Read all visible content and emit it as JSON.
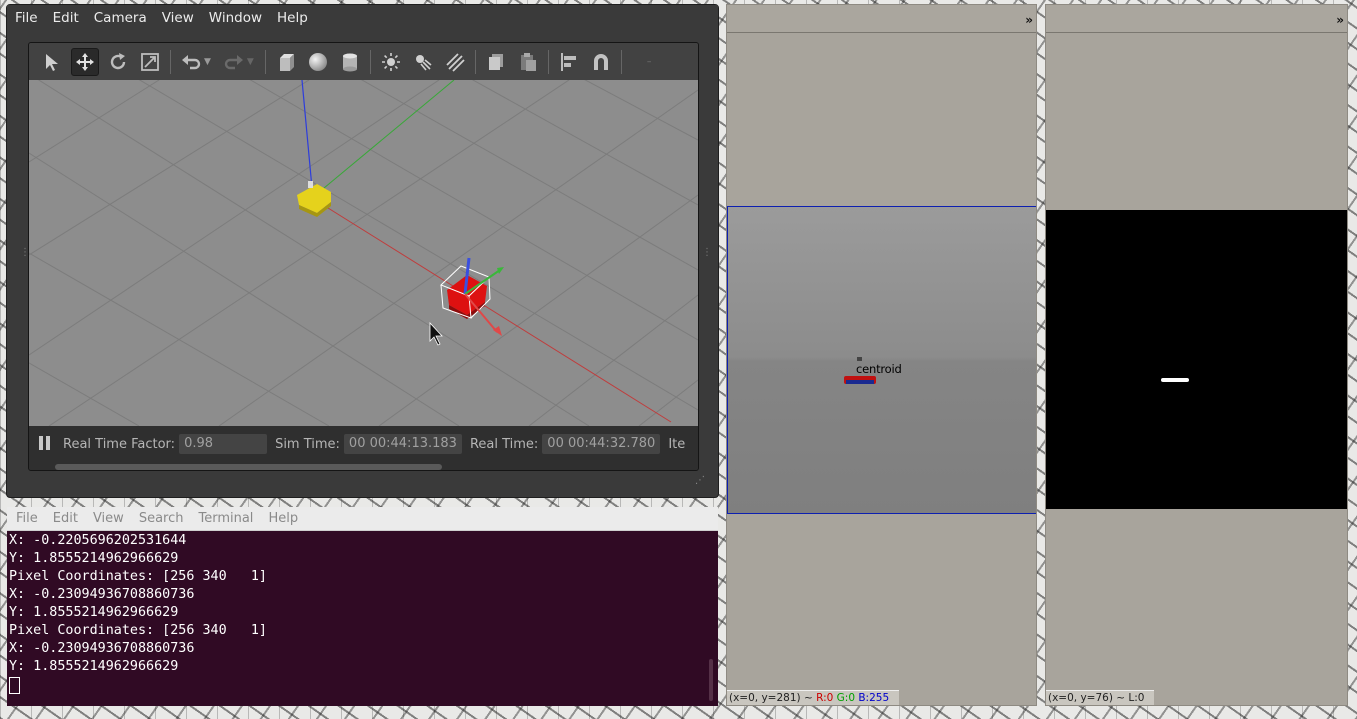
{
  "gazebo": {
    "menu": [
      "File",
      "Edit",
      "Camera",
      "View",
      "Window",
      "Help"
    ],
    "toolbar_icons": [
      "select-arrow-icon",
      "translate-icon",
      "rotate-icon",
      "scale-icon",
      "undo-icon",
      "undo-dropdown-icon",
      "redo-icon",
      "redo-dropdown-icon",
      "box-shape-icon",
      "sphere-shape-icon",
      "cylinder-shape-icon",
      "point-light-icon",
      "spot-light-icon",
      "directional-light-icon",
      "copy-icon",
      "paste-icon",
      "align-icon",
      "snap-magnet-icon"
    ],
    "status": {
      "real_time_factor_label": "Real Time Factor:",
      "real_time_factor": "0.98",
      "sim_time_label": "Sim Time:",
      "sim_time": "00 00:44:13.183",
      "real_time_label": "Real Time:",
      "real_time": "00 00:44:32.780",
      "iterations_label": "Ite"
    }
  },
  "terminal": {
    "menu": [
      "File",
      "Edit",
      "View",
      "Search",
      "Terminal",
      "Help"
    ],
    "lines": [
      "X: -0.2205696202531644",
      "Y: 1.8555214962966629",
      "Pixel Coordinates: [256 340   1]",
      "X: -0.23094936708860736",
      "Y: 1.8555214962966629",
      "Pixel Coordinates: [256 340   1]",
      "X: -0.23094936708860736",
      "Y: 1.8555214962966629"
    ]
  },
  "camera_view": {
    "expand_symbol": "»",
    "centroid_label": "centroid",
    "status_prefix": "(x=0, y=281) ~ ",
    "status_r": "R:0",
    "status_g": "G:0",
    "status_b": "B:255",
    "colors": {
      "r": "#cc0000",
      "g": "#00a000",
      "b": "#0000cc"
    }
  },
  "mask_view": {
    "expand_symbol": "»",
    "status": "(x=0, y=76) ~ L:0"
  }
}
